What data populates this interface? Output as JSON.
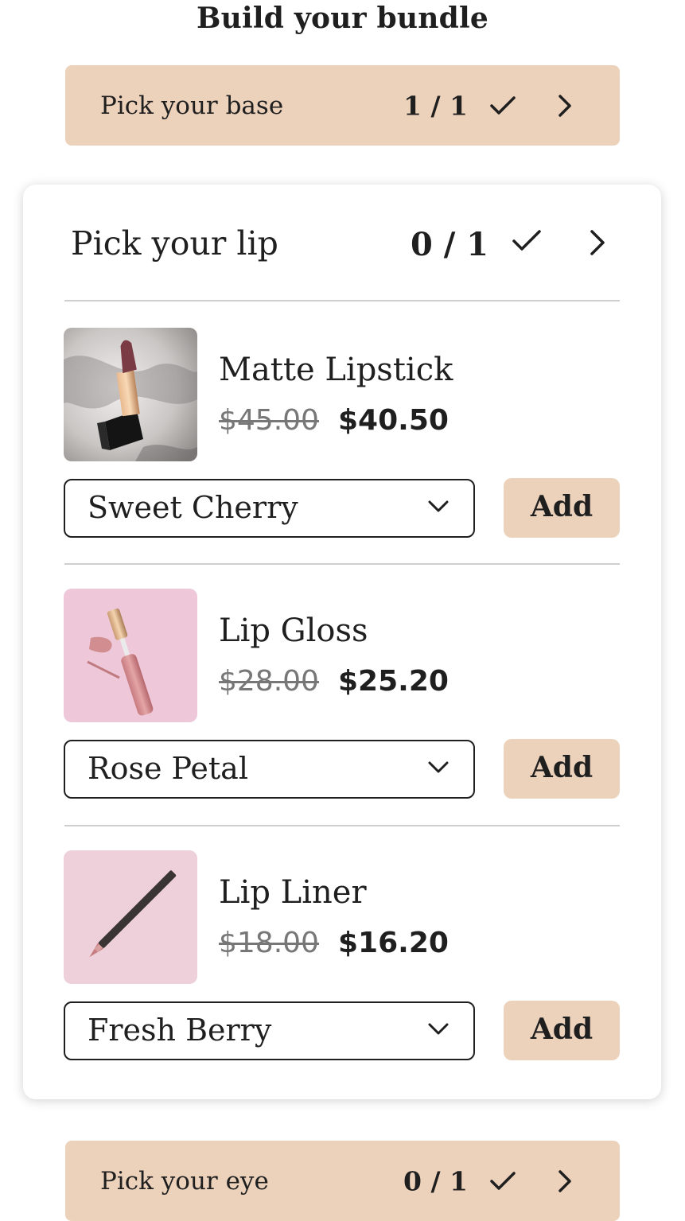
{
  "colors": {
    "accent": "#ecd2bb",
    "text": "#1f1f1f"
  },
  "page_title": "Build your bundle",
  "steps": {
    "base": {
      "label": "Pick your base",
      "count": "1 / 1"
    },
    "lip": {
      "label": "Pick your lip",
      "count": "0 / 1"
    },
    "eye": {
      "label": "Pick your eye",
      "count": "0 / 1"
    }
  },
  "products": [
    {
      "name": "Matte Lipstick",
      "old_price": "$45.00",
      "price": "$40.50",
      "variant": "Sweet Cherry",
      "add_label": "Add",
      "image": "lipstick-image"
    },
    {
      "name": "Lip Gloss",
      "old_price": "$28.00",
      "price": "$25.20",
      "variant": "Rose Petal",
      "add_label": "Add",
      "image": "lip-gloss-image"
    },
    {
      "name": "Lip Liner",
      "old_price": "$18.00",
      "price": "$16.20",
      "variant": "Fresh Berry",
      "add_label": "Add",
      "image": "lip-liner-image"
    }
  ],
  "icons": {
    "check": "check-icon",
    "chevron_right": "chevron-right-icon",
    "chevron_down": "chevron-down-icon"
  }
}
